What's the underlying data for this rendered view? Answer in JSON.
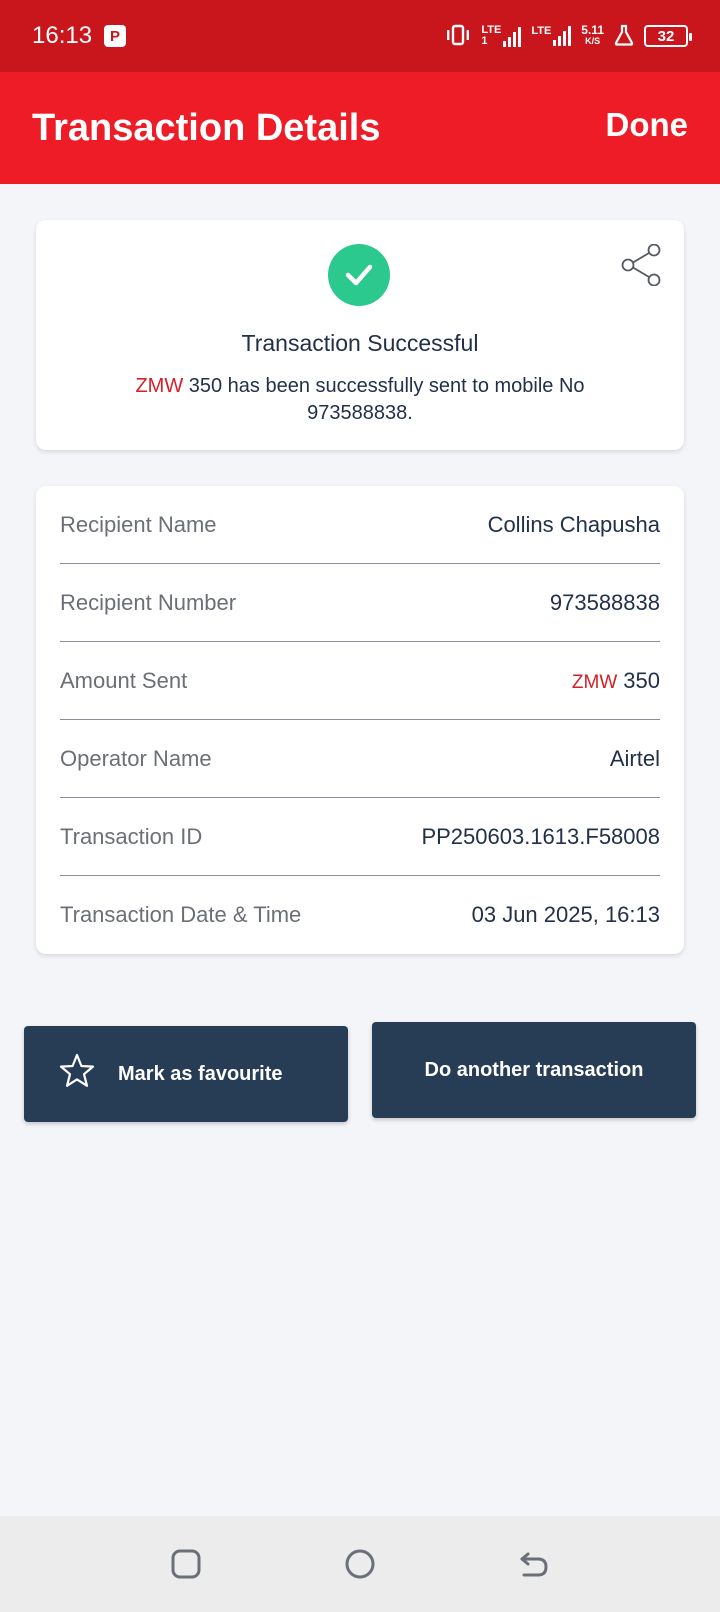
{
  "status_bar": {
    "time": "16:13",
    "badge": "P",
    "lte1": "LTE",
    "lte1_sub": "1",
    "lte2": "LTE",
    "speed_value": "5.11",
    "speed_unit": "K/S",
    "battery": "32",
    "icons": [
      "vibrate-icon",
      "signal-icon",
      "signal-icon",
      "lab-icon",
      "battery-icon"
    ]
  },
  "app_bar": {
    "title": "Transaction Details",
    "done_label": "Done"
  },
  "success": {
    "icon": "check-circle-icon",
    "share_icon": "share-icon",
    "title": "Transaction Successful",
    "currency": "ZMW",
    "message": " 350 has been successfully sent to mobile No 973588838."
  },
  "details": {
    "rows": [
      {
        "label": "Recipient Name",
        "value": "Collins Chapusha"
      },
      {
        "label": "Recipient Number",
        "value": "973588838"
      },
      {
        "label": "Amount Sent",
        "currency": "ZMW",
        "value": "350"
      },
      {
        "label": "Operator Name",
        "value": "Airtel"
      },
      {
        "label": "Transaction ID",
        "value": "PP250603.1613.F58008"
      },
      {
        "label": "Transaction Date & Time",
        "value": "03 Jun 2025, 16:13"
      }
    ]
  },
  "actions": {
    "favourite_label": "Mark as favourite",
    "favourite_icon": "star-icon",
    "another_label": "Do another transaction"
  },
  "nav": {
    "icons": [
      "recents-icon",
      "home-icon",
      "back-icon"
    ]
  },
  "colors": {
    "status_bar": "#c8161c",
    "app_bar": "#ee1c27",
    "success_green": "#2bc98e",
    "button": "#273c55",
    "currency": "#d51f26"
  }
}
